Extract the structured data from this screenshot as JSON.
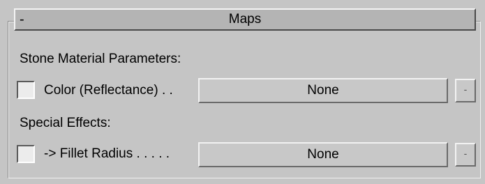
{
  "rollout": {
    "collapse_symbol": "-",
    "title": "Maps"
  },
  "sections": [
    {
      "heading": "Stone Material Parameters:",
      "row": {
        "checked": false,
        "label": "Color (Reflectance) . .",
        "map_value": "None",
        "small_button": "-"
      }
    },
    {
      "heading": "Special Effects:",
      "row": {
        "checked": false,
        "label": "-> Fillet Radius . . . . .",
        "map_value": "None",
        "small_button": "-"
      }
    }
  ],
  "colors": {
    "panel_bg": "#c5c5c5",
    "header_bg": "#b4b4b4",
    "checkbox_bg": "#ececec"
  }
}
